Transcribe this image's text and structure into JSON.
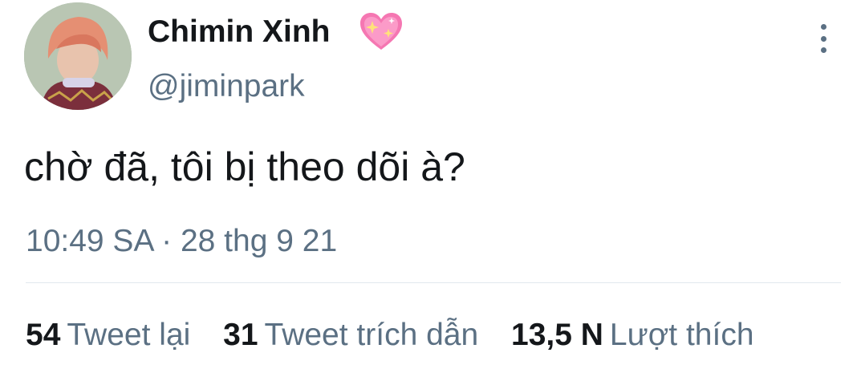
{
  "tweet": {
    "display_name": "Chimin Xinh",
    "name_icon": "sparkling-heart-icon",
    "handle": "@jiminpark",
    "text": "chờ đã, tôi bị theo dõi à?",
    "timestamp": "10:49 SA · 28 thg 9 21",
    "more_icon": "more-vertical-icon",
    "stats": [
      {
        "count": "54",
        "label": "Tweet lại"
      },
      {
        "count": "31",
        "label": "Tweet trích dẫn"
      },
      {
        "count": "13,5 N",
        "label": "Lượt thích"
      }
    ]
  },
  "colors": {
    "text_primary": "#14171a",
    "text_secondary": "#5b7083",
    "heart": "#f577b2",
    "divider": "#e1e8ed"
  }
}
